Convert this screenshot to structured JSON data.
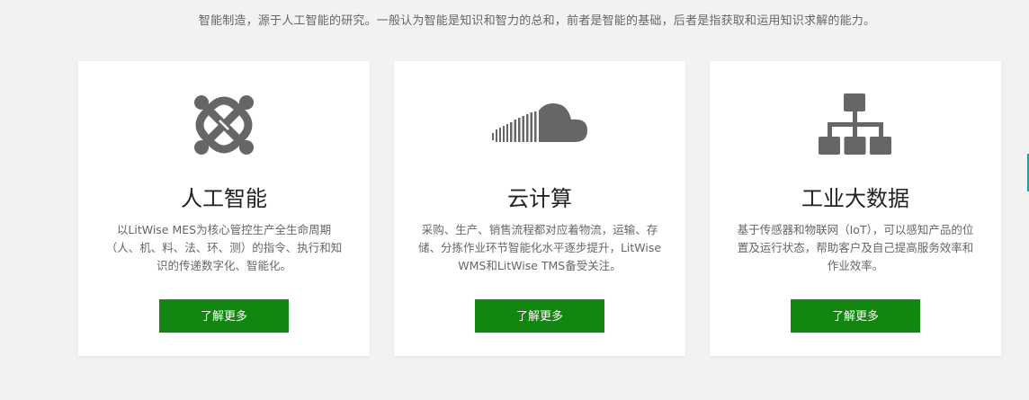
{
  "intro": {
    "text": "智能制造，源于人工智能的研究。一般认为智能是知识和智力的总和，前者是智能的基础，后者是指获取和运用知识求解的能力。"
  },
  "colors": {
    "button": "#11870f",
    "icon": "#666666",
    "background": "#f2f2f2",
    "card": "#ffffff"
  },
  "cards": [
    {
      "icon": "joomla-icon",
      "title": "人工智能",
      "description": "以LitWise MES为核心管控生产全生命周期（人、机、料、法、环、测）的指令、执行和知识的传递数字化、智能化。",
      "button_label": "了解更多"
    },
    {
      "icon": "soundcloud-cloud-icon",
      "title": "云计算",
      "description": "采购、生产、销售流程都对应着物流，运输、存储、分拣作业环节智能化水平逐步提升，LitWise WMS和LitWise TMS备受关注。",
      "button_label": "了解更多"
    },
    {
      "icon": "sitemap-icon",
      "title": "工业大数据",
      "description": "基于传感器和物联网（IoT），可以感知产品的位置及运行状态，帮助客户及自己提高服务效率和作业效率。",
      "button_label": "了解更多"
    }
  ]
}
